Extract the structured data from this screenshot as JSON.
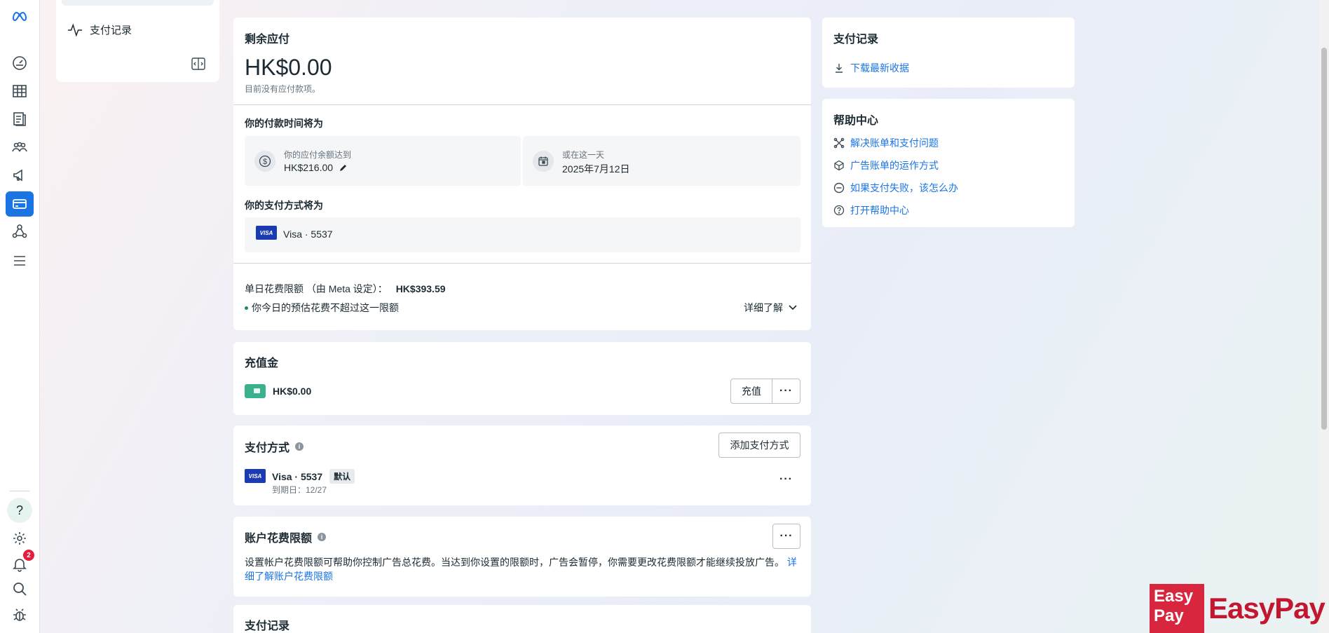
{
  "nav": {
    "item_label": "支付记录"
  },
  "balance": {
    "title": "剩余应付",
    "amount": "HK$0.00",
    "note": "目前没有应付款项。"
  },
  "schedule": {
    "title": "你的付款时间将为",
    "threshold_label": "你的应付余额达到",
    "threshold_value": "HK$216.00",
    "date_label": "或在这一天",
    "date_value": "2025年7月12日"
  },
  "method": {
    "title": "你的支付方式将为",
    "card": "Visa · 5537",
    "visa_logo": "VISA"
  },
  "daily_limit": {
    "label": "单日花费限额 （由 Meta 设定）：",
    "value": "HK$393.59",
    "note": "你今日的预估花费不超过这一限额",
    "learn_more": "详细了解"
  },
  "prepaid": {
    "title": "充值金",
    "amount": "HK$0.00",
    "topup_button": "充值",
    "more": "···"
  },
  "payment_methods": {
    "title": "支付方式",
    "add_button": "添加支付方式",
    "card": "Visa · 5537",
    "default_tag": "默认",
    "expiry": "到期日：12/27",
    "more": "···"
  },
  "spending_limit": {
    "title": "账户花费限额",
    "more": "···",
    "description": "设置帐户花费限额可帮助你控制广告总花费。当达到你设置的限额时，广告会暂停，你需要更改花费限额才能继续投放广告。",
    "link_part1": "详",
    "link_part2": "细了解账户花费限额"
  },
  "history": {
    "title": "支付记录"
  },
  "right_history": {
    "title": "支付记录",
    "download": "下载最新收据"
  },
  "help": {
    "title": "帮助中心",
    "links": [
      "解决账单和支付问题",
      "广告账单的运作方式",
      "如果支付失败，该怎么办",
      "打开帮助中心"
    ]
  },
  "rail": {
    "help_glyph": "?",
    "notification_count": "2"
  },
  "watermark": {
    "box_line1": "Easy",
    "box_line2": "Pay",
    "text": "EasyPay"
  },
  "colors": {
    "accent": "#1b74e4",
    "visa": "#1a3bb3",
    "badge": "#e41e3f",
    "wallet": "#3bb08f"
  }
}
